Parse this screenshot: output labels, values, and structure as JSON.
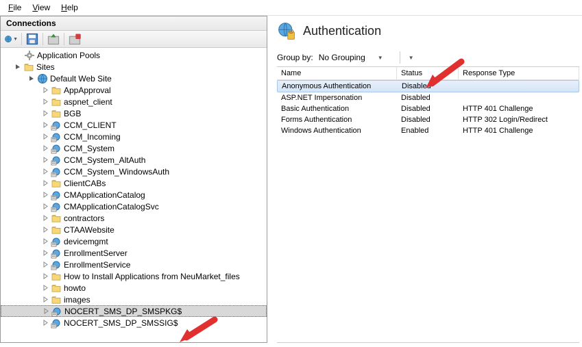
{
  "menu": {
    "file": "File",
    "view": "View",
    "help": "Help"
  },
  "connections_title": "Connections",
  "tree": {
    "app_pools": "Application Pools",
    "sites": "Sites",
    "default_site": "Default Web Site",
    "children": [
      "AppApproval",
      "aspnet_client",
      "BGB",
      "CCM_CLIENT",
      "CCM_Incoming",
      "CCM_System",
      "CCM_System_AltAuth",
      "CCM_System_WindowsAuth",
      "ClientCABs",
      "CMApplicationCatalog",
      "CMApplicationCatalogSvc",
      "contractors",
      "CTAAWebsite",
      "devicemgmt",
      "EnrollmentServer",
      "EnrollmentService",
      "How to Install Applications from NeuMarket_files",
      "howto",
      "images",
      "NOCERT_SMS_DP_SMSPKG$",
      "NOCERT_SMS_DP_SMSSIG$"
    ]
  },
  "page_title": "Authentication",
  "groupby": {
    "label": "Group by:",
    "value": "No Grouping"
  },
  "columns": {
    "name": "Name",
    "status": "Status",
    "response": "Response Type"
  },
  "rows": [
    {
      "name": "Anonymous Authentication",
      "status": "Disabled",
      "resp": "",
      "selected": true
    },
    {
      "name": "ASP.NET Impersonation",
      "status": "Disabled",
      "resp": ""
    },
    {
      "name": "Basic Authentication",
      "status": "Disabled",
      "resp": "HTTP 401 Challenge"
    },
    {
      "name": "Forms Authentication",
      "status": "Disabled",
      "resp": "HTTP 302 Login/Redirect"
    },
    {
      "name": "Windows Authentication",
      "status": "Enabled",
      "resp": "HTTP 401 Challenge"
    }
  ]
}
